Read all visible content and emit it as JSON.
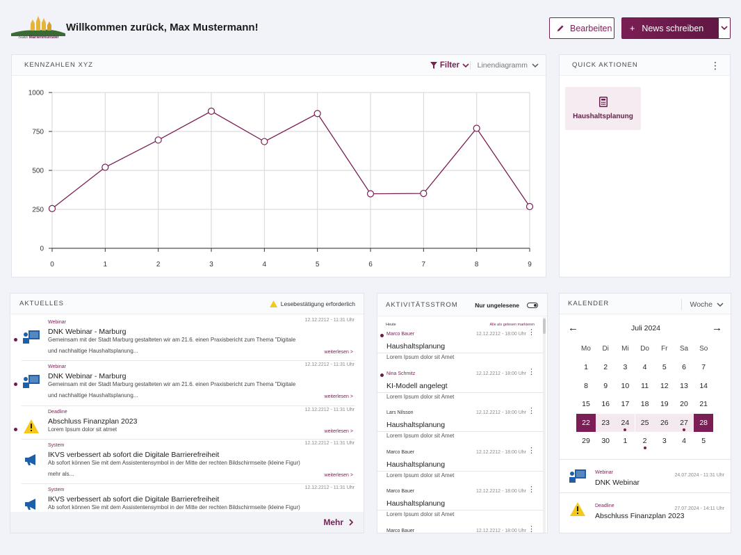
{
  "header": {
    "logo_caption_prefix": "Stadt",
    "logo_caption_name": "Marienmünster",
    "welcome": "Willkommen zurück, Max Mustermann!",
    "edit_label": "Bearbeiten",
    "news_button_label": "News schreiben",
    "news_button_plus": "+"
  },
  "colors": {
    "brand": "#7a1e55",
    "brand_light": "#f5e9f0",
    "warning": "#f4c81c",
    "icon_blue": "#1f5fa8"
  },
  "kpi": {
    "title": "KENNZAHLEN XYZ",
    "filter_label": "Filter",
    "chart_type_label": "Linendiagramm"
  },
  "chart_data": {
    "type": "line",
    "x": [
      0,
      1,
      2,
      3,
      4,
      5,
      6,
      7,
      8,
      9
    ],
    "series": [
      {
        "values": [
          255,
          520,
          695,
          880,
          685,
          865,
          350,
          352,
          770,
          268
        ]
      }
    ],
    "yticks": [
      0,
      250,
      500,
      750,
      1000
    ],
    "ylim": [
      0,
      1000
    ],
    "xlim": [
      0,
      9
    ],
    "grid": true
  },
  "quick": {
    "title": "QUICK AKTIONEN",
    "tiles": [
      {
        "label": "Haushaltsplanung",
        "icon": "calculator-icon"
      }
    ]
  },
  "news": {
    "title": "AKTUELLES",
    "notice": "Lesebestätigung erforderlich",
    "more_label": "Mehr",
    "items": [
      {
        "category": "Webinar",
        "time": "12.12.2212 - 11:31 Uhr",
        "title": "DNK Webinar - Marburg",
        "text1": "Gemeinsam mit der Stadt Marburg gestalteten wir am 21.6. einen Praxisbericht zum Thema \"Digitale",
        "text2": "und nachhaltige Haushaltsplanung...",
        "more": "weiterlesen >",
        "icon": "webinar-icon",
        "unread": true
      },
      {
        "category": "Webinar",
        "time": "12.12.2212 - 11:31 Uhr",
        "title": "DNK Webinar - Marburg",
        "text1": "Gemeinsam mit der Stadt Marburg gestalteten wir am 21.6. einen Praxisbericht zum Thema \"Digitale",
        "text2": "und nachhaltige Haushaltsplanung...",
        "more": "weiterlesen >",
        "icon": "webinar-icon",
        "unread": true
      },
      {
        "category": "Deadline",
        "time": "12.12.2212 - 11:31 Uhr",
        "title": "Abschluss Finanzplan 2023",
        "text1": "Lorem Ipsum dolor sit atmet",
        "text2": "",
        "more": "weiterlesen >",
        "icon": "warning-icon",
        "unread": true
      },
      {
        "category": "System",
        "time": "12.12.2212 - 11:31 Uhr",
        "title": "IKVS verbessert ab sofort die Digitale Barrierefreiheit",
        "text1": "Ab sofort können Sie mit dem Assistentensymbol in der Mitte der rechten Bildschirmseite  (kleine Figur)",
        "text2": "mehr als...",
        "more": "weiterlesen >",
        "icon": "megaphone-icon",
        "unread": false
      },
      {
        "category": "System",
        "time": "12.12.2212 - 11:31 Uhr",
        "title": "IKVS verbessert ab sofort die Digitale Barrierefreiheit",
        "text1": "Ab sofort können Sie mit dem Assistentensymbol in der Mitte der rechten Bildschirmseite  (kleine Figur)",
        "text2": "",
        "more": "",
        "icon": "megaphone-icon",
        "unread": false
      }
    ]
  },
  "activity": {
    "title": "AKTIVITÄTSSTROM",
    "toggle_label": "Nur ungelesene",
    "today": "Heute",
    "mark_all": "Alle als gelesen markieren",
    "items": [
      {
        "user": "Marco Bauer",
        "time": "12.12.2212 - 18:00 Uhr",
        "title": "Haushaltsplanung",
        "desc": "Lorem Ipsum dolor sit Amet",
        "unread": true
      },
      {
        "user": "Nina Schmitz",
        "time": "12.12.2212 - 18:00 Uhr",
        "title": "KI-Modell angelegt",
        "desc": "Lorem Ipsum dolor sit Amet",
        "unread": true
      },
      {
        "user": "Lars Nilsson",
        "time": "12.12.2212 - 18:00 Uhr",
        "title": "Haushaltsplanung",
        "desc": "Lorem Ipsum dolor sit Amet",
        "unread": false
      },
      {
        "user": "Marco Bauer",
        "time": "12.12.2212 - 18:00 Uhr",
        "title": "Haushaltsplanung",
        "desc": "Lorem Ipsum dolor sit Amet",
        "unread": false
      },
      {
        "user": "Marco Bauer",
        "time": "12.12.2212 - 18:00 Uhr",
        "title": "Haushaltsplanung",
        "desc": "Lorem Ipsum dolor sit Amet",
        "unread": false
      },
      {
        "user": "Marco Bauer",
        "time": "12.12.2212 - 18:00 Uhr",
        "title": "",
        "desc": "",
        "unread": false
      }
    ]
  },
  "calendar": {
    "title": "KALENDER",
    "view_label": "Woche",
    "month": "Juli 2024",
    "prev": "←",
    "next": "→",
    "weekdays": [
      "Mo",
      "Di",
      "Mi",
      "Do",
      "Fr",
      "Sa",
      "So"
    ],
    "weeks": [
      [
        {
          "d": "1"
        },
        {
          "d": "2"
        },
        {
          "d": "3"
        },
        {
          "d": "4"
        },
        {
          "d": "5"
        },
        {
          "d": "6"
        },
        {
          "d": "7"
        }
      ],
      [
        {
          "d": "8"
        },
        {
          "d": "9"
        },
        {
          "d": "10"
        },
        {
          "d": "11"
        },
        {
          "d": "12"
        },
        {
          "d": "13"
        },
        {
          "d": "14"
        }
      ],
      [
        {
          "d": "15"
        },
        {
          "d": "16"
        },
        {
          "d": "17"
        },
        {
          "d": "18"
        },
        {
          "d": "19"
        },
        {
          "d": "20"
        },
        {
          "d": "21"
        }
      ],
      [
        {
          "d": "22",
          "state": "sel"
        },
        {
          "d": "23",
          "state": "band"
        },
        {
          "d": "24",
          "state": "band",
          "dot": true
        },
        {
          "d": "25",
          "state": "band"
        },
        {
          "d": "26",
          "state": "band"
        },
        {
          "d": "27",
          "state": "band",
          "dot": true
        },
        {
          "d": "28",
          "state": "sel"
        }
      ],
      [
        {
          "d": "29"
        },
        {
          "d": "30"
        },
        {
          "d": "1"
        },
        {
          "d": "2",
          "dot": true
        },
        {
          "d": "3"
        },
        {
          "d": "4"
        },
        {
          "d": "5"
        }
      ]
    ],
    "events": [
      {
        "category": "Webinar",
        "time": "24.07.2024 - 11:31 Uhr",
        "title": "DNK Webinar",
        "icon": "webinar-icon"
      },
      {
        "category": "Deadline",
        "time": "27.07.2024 - 14:11 Uhr",
        "title": "Abschluss Finanzplan 2023",
        "icon": "warning-icon"
      }
    ]
  }
}
